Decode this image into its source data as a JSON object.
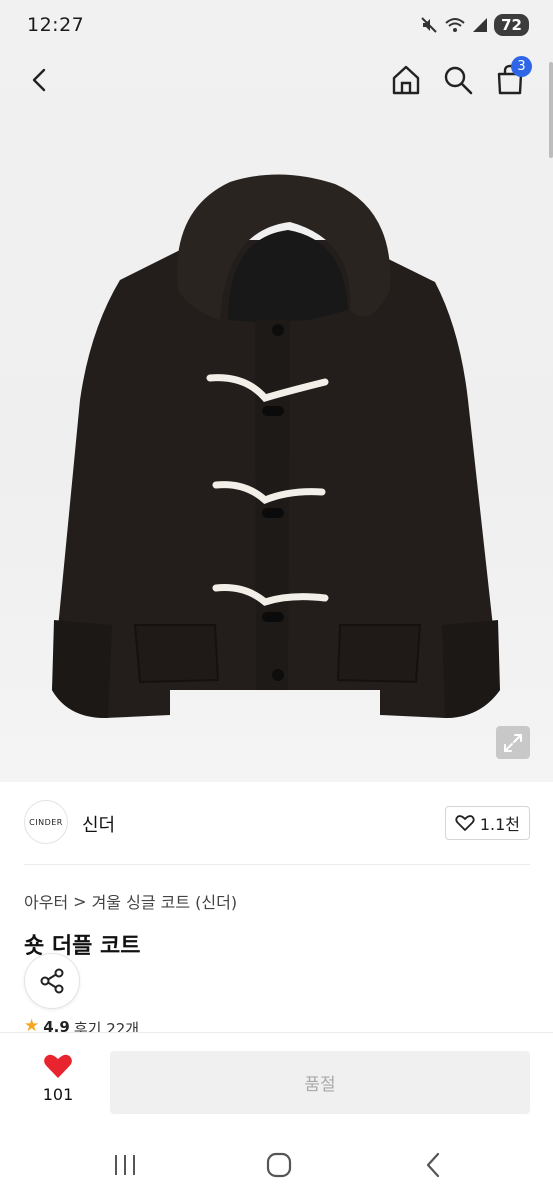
{
  "status_bar": {
    "time": "12:27",
    "battery": "72",
    "icons": [
      "mute-icon",
      "wifi-icon",
      "signal-icon"
    ]
  },
  "top_nav": {
    "cart_count": "3",
    "icons": [
      "back-arrow-icon",
      "home-icon",
      "search-icon",
      "shopping-bag-icon"
    ]
  },
  "hero": {
    "image": "black duffle coat with hood and white rope toggles",
    "expand_icon": "expand-icon"
  },
  "brand": {
    "logo_text": "CINDER",
    "name": "신더",
    "like_count": "1.1천"
  },
  "breadcrumb": {
    "category": "아우터",
    "separator": ">",
    "subcategory": "겨울 싱글 코트 (신더)"
  },
  "product": {
    "title": "숏 더플 코트",
    "rating": "4.9",
    "reviews": "후기 22개"
  },
  "bottom_bar": {
    "wish_count": "101",
    "buy_label": "품절"
  },
  "colors": {
    "accent_blue": "#2f66e8",
    "heart_red": "#e8242f",
    "star": "#f5a623"
  }
}
